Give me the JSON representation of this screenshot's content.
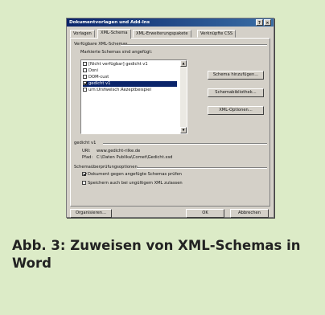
{
  "dialog": {
    "title": "Dokumentvorlagen und Add-Ins",
    "help_button": "?",
    "close_button": "×",
    "tabs": [
      {
        "label": "Vorlagen"
      },
      {
        "label": "XML-Schema"
      },
      {
        "label": "XML-Erweiterungspakete"
      },
      {
        "label": "Verknüpfte CSS"
      }
    ],
    "available_schemas_label": "Verfügbare XML-Schemas",
    "checked_schemas_label": "Markierte Schemas sind angefügt:",
    "schemas": [
      {
        "label": "[Nicht verfügbar] gedicht v1",
        "checked": false,
        "selected": false
      },
      {
        "label": "Doni",
        "checked": false,
        "selected": false
      },
      {
        "label": "DOM-cust",
        "checked": false,
        "selected": false
      },
      {
        "label": "gedicht v1",
        "checked": true,
        "selected": true
      },
      {
        "label": "urn:Ursfwelsch.Rezeptbeispiel",
        "checked": false,
        "selected": false
      }
    ],
    "side_buttons": {
      "add_schema": "Schema hinzufügen...",
      "schema_library": "Schemabibliothek...",
      "xml_options": "XML-Optionen..."
    },
    "details": {
      "name": "gedicht v1",
      "uri_label": "URI:",
      "uri_value": "www.gedicht-rilke.de",
      "path_label": "Pfad:",
      "path_value": "C:\\Daten Publika\\Comet\\Gedicht.xsd"
    },
    "validation": {
      "heading": "Schemaüberprüfungsoptionen",
      "validate_label": "Dokument gegen angefügte Schemas prüfen",
      "validate_checked": true,
      "save_invalid_label": "Speichern auch bei ungültigem XML zulassen",
      "save_invalid_checked": false
    },
    "footer": {
      "organize": "Organisieren...",
      "ok": "OK",
      "cancel": "Abbrechen"
    }
  },
  "caption": "Abb. 3: Zuweisen von XML-Schemas in Word",
  "colors": {
    "panel_bg": "#dcebc7",
    "title_bar": "#0a246a",
    "dialog_bg": "#d4d0c8"
  }
}
